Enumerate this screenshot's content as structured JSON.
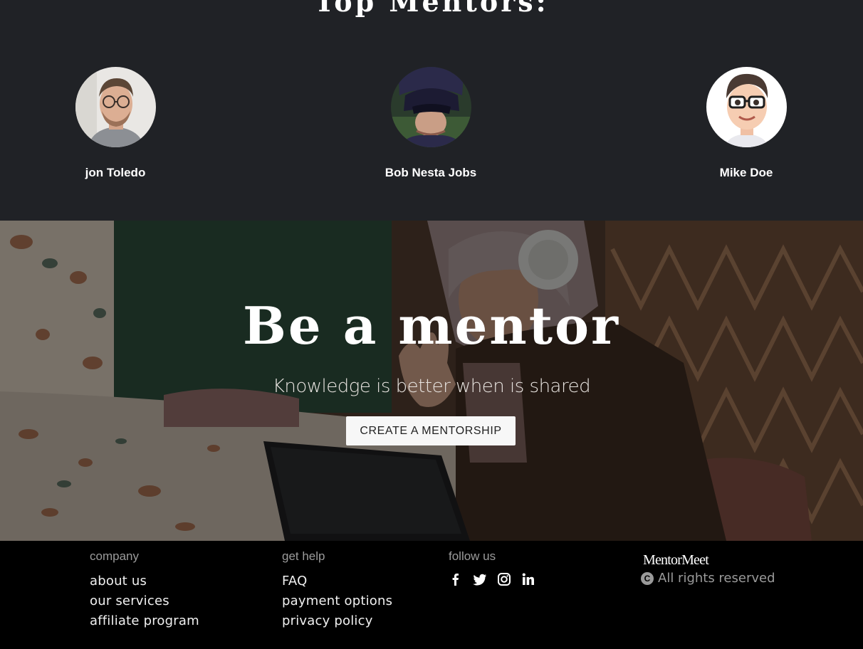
{
  "mentors_section": {
    "title": "Top Mentors:",
    "mentors": [
      {
        "name": "jon Toledo"
      },
      {
        "name": "Bob Nesta Jobs"
      },
      {
        "name": "Mike Doe"
      }
    ]
  },
  "hero": {
    "title": "Be a mentor",
    "subtitle": "Knowledge is better when is shared",
    "cta_label": "CREATE A MENTORSHIP"
  },
  "footer": {
    "company": {
      "heading": "company",
      "links": [
        "about us",
        "our services",
        "affiliate program"
      ]
    },
    "help": {
      "heading": "get help",
      "links": [
        "FAQ",
        "payment options",
        "privacy policy"
      ]
    },
    "follow": {
      "heading": "follow us",
      "icons": [
        "facebook-icon",
        "twitter-icon",
        "instagram-icon",
        "linkedin-icon"
      ]
    },
    "brand": "MentorMeet",
    "copyright_symbol": "C",
    "rights": "All rights reserved"
  },
  "colors": {
    "mentors_bg": "#202226",
    "footer_bg": "#000000",
    "cta_bg": "#f7f7f7"
  }
}
